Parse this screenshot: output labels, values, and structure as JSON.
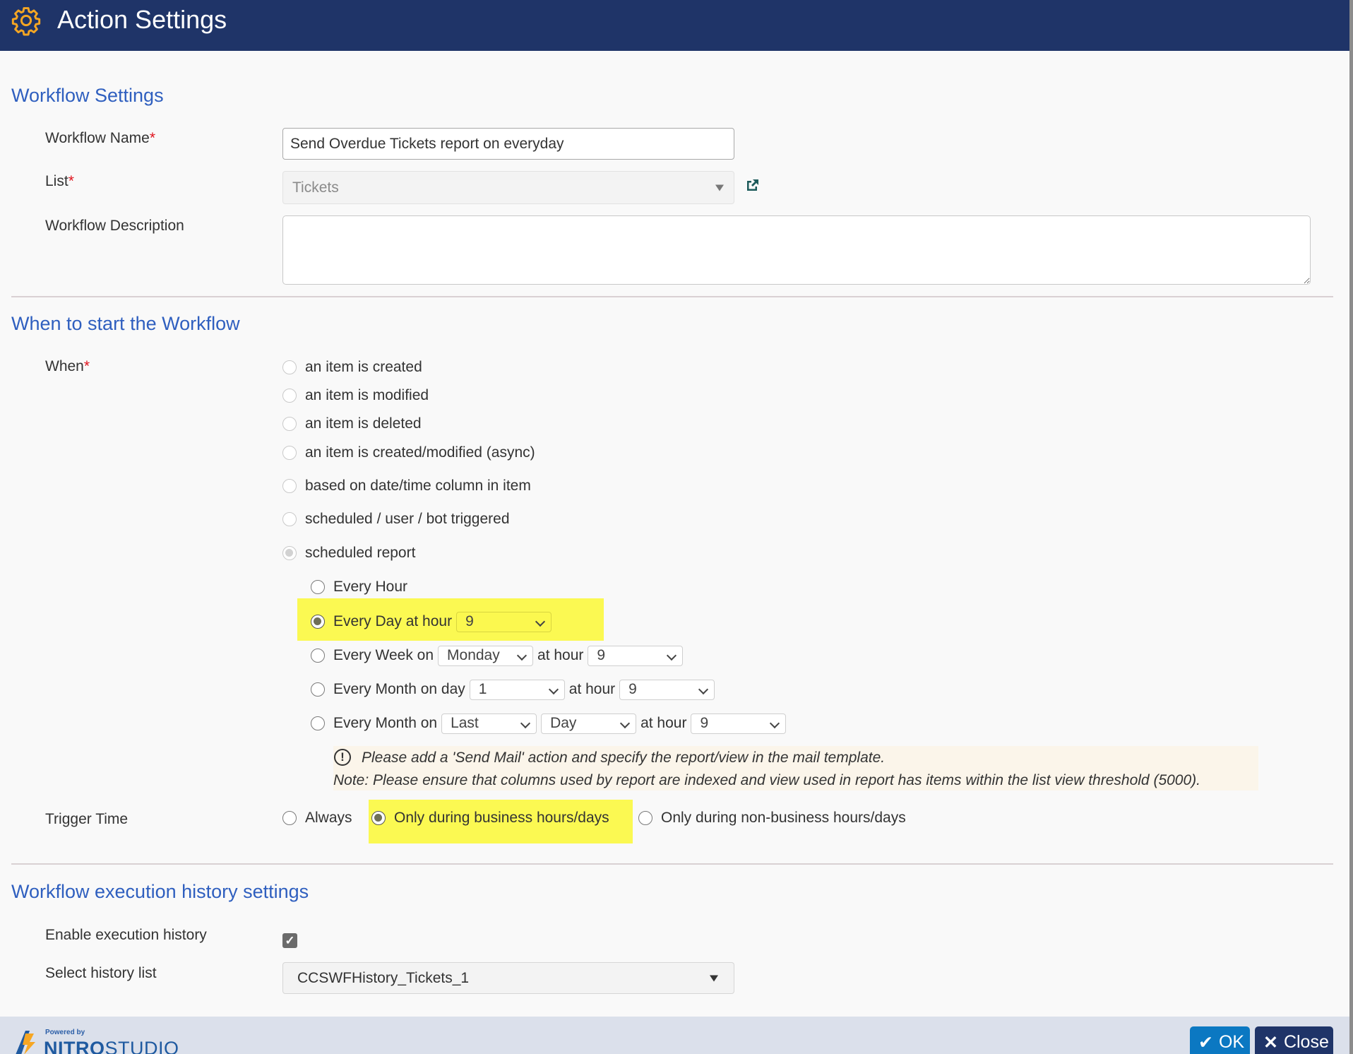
{
  "header": {
    "title": "Action Settings",
    "icon": "gear-icon",
    "icon_color": "#f5a623",
    "bg_color": "#1f3468"
  },
  "workflow_settings": {
    "section_title": "Workflow Settings",
    "name_label": "Workflow Name",
    "name_value": "Send Overdue Tickets report on everyday",
    "list_label": "List",
    "list_value": "Tickets",
    "description_label": "Workflow Description",
    "description_value": "",
    "required_mark": "*"
  },
  "when_to_start": {
    "section_title": "When to start the Workflow",
    "when_label": "When",
    "options": [
      {
        "label": "an item is created",
        "checked": false
      },
      {
        "label": "an item is modified",
        "checked": false
      },
      {
        "label": "an item is deleted",
        "checked": false
      },
      {
        "label": "an item is created/modified (async)",
        "checked": false
      },
      {
        "label": "based on date/time column in item",
        "checked": false
      },
      {
        "label": "scheduled / user / bot triggered",
        "checked": false
      },
      {
        "label": "scheduled report",
        "checked": true
      }
    ],
    "schedule": {
      "every_hour": "Every Hour",
      "every_day": "Every Day at hour",
      "every_day_hour": "9",
      "every_week": "Every Week on",
      "every_week_day": "Monday",
      "at_hour": "at hour",
      "every_week_hour": "9",
      "every_month_day": "Every Month on day",
      "every_month_day_value": "1",
      "every_month_day_hour": "9",
      "every_month_on": "Every Month on",
      "every_month_on_which": "Last",
      "every_month_on_unit": "Day",
      "every_month_on_hour": "9",
      "selected": "Every Day at hour"
    },
    "notice": {
      "line1": "Please add a 'Send Mail' action and specify the report/view in the mail template.",
      "line2": "Note: Please ensure that columns used by report are indexed and view used in report has items within the list view threshold (5000).",
      "icon": "!"
    },
    "trigger_time": {
      "label": "Trigger Time",
      "options": [
        {
          "label": "Always",
          "checked": false
        },
        {
          "label": "Only during business hours/days",
          "checked": true
        },
        {
          "label": "Only during non-business hours/days",
          "checked": false
        }
      ]
    },
    "highlight_color": "#fbf952"
  },
  "history": {
    "section_title": "Workflow execution history settings",
    "enable_label": "Enable execution history",
    "enable_checked": true,
    "check_glyph": "✓",
    "select_label": "Select history list",
    "select_value": "CCSWFHistory_Tickets_1"
  },
  "footer": {
    "powered_by": "Powered by",
    "brand_bold": "NITRO",
    "brand_light": "STUDIO",
    "ok_label": "OK",
    "close_label": "Close",
    "ok_glyph": "✔",
    "close_glyph": "✕"
  }
}
